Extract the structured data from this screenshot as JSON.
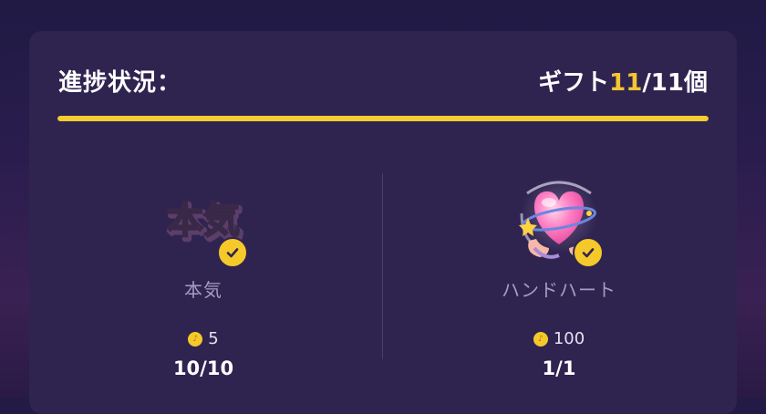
{
  "header": {
    "progress_label": "進捗状況：",
    "gift_prefix": "ギフト",
    "gift_done": "11",
    "gift_total_suffix": "/11個"
  },
  "progress": {
    "fraction": 1.0,
    "fill_color": "#f6cd2e"
  },
  "items": [
    {
      "name": "本気",
      "image_text": "本気",
      "price": "5",
      "count": "10/10",
      "icon": "honki-text-sticker-icon",
      "completed": true
    },
    {
      "name": "ハンドハート",
      "price": "100",
      "count": "1/1",
      "icon": "hand-heart-icon",
      "completed": true
    }
  ],
  "colors": {
    "accent": "#f7c531",
    "card": "#2f2450",
    "muted_text": "#a79cc0"
  }
}
